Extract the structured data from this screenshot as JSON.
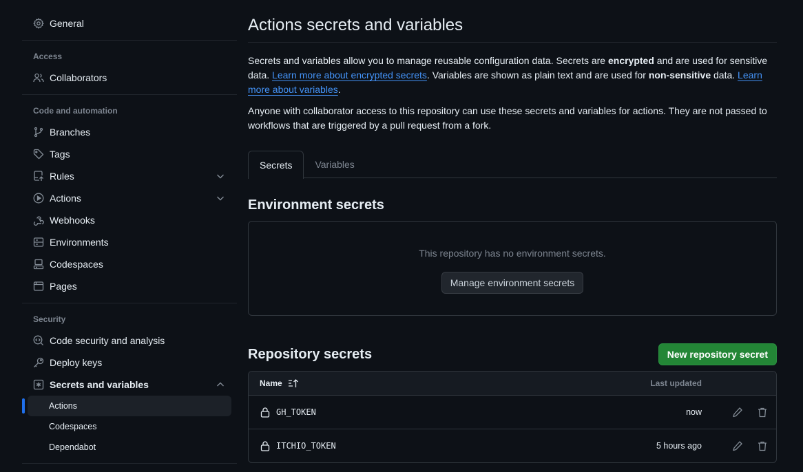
{
  "sidebar": {
    "general": {
      "label": "General",
      "icon": "gear-icon"
    },
    "sections": [
      {
        "heading": "Access",
        "items": [
          {
            "label": "Collaborators",
            "icon": "people-icon"
          }
        ]
      },
      {
        "heading": "Code and automation",
        "items": [
          {
            "label": "Branches",
            "icon": "git-branch-icon"
          },
          {
            "label": "Tags",
            "icon": "tag-icon"
          },
          {
            "label": "Rules",
            "icon": "rules-icon",
            "expandable": true,
            "expanded": false
          },
          {
            "label": "Actions",
            "icon": "play-icon",
            "expandable": true,
            "expanded": false
          },
          {
            "label": "Webhooks",
            "icon": "webhook-icon"
          },
          {
            "label": "Environments",
            "icon": "server-icon"
          },
          {
            "label": "Codespaces",
            "icon": "codespaces-icon"
          },
          {
            "label": "Pages",
            "icon": "browser-icon"
          }
        ]
      },
      {
        "heading": "Security",
        "items": [
          {
            "label": "Code security and analysis",
            "icon": "codescan-icon"
          },
          {
            "label": "Deploy keys",
            "icon": "key-icon"
          },
          {
            "label": "Secrets and variables",
            "icon": "asterisk-icon",
            "expandable": true,
            "expanded": true,
            "children": [
              {
                "label": "Actions",
                "active": true
              },
              {
                "label": "Codespaces"
              },
              {
                "label": "Dependabot"
              }
            ]
          }
        ]
      }
    ]
  },
  "main": {
    "title": "Actions secrets and variables",
    "description": {
      "p1_a": "Secrets and variables allow you to manage reusable configuration data. Secrets are ",
      "p1_bold1": "encrypted",
      "p1_b": " and are used for sensitive data. ",
      "p1_link1": "Learn more about encrypted secrets",
      "p1_c": ". Variables are shown as plain text and are used for ",
      "p1_bold2": "non-sensitive",
      "p1_d": " data. ",
      "p1_link2": "Learn more about variables",
      "p1_e": ".",
      "p2": "Anyone with collaborator access to this repository can use these secrets and variables for actions. They are not passed to workflows that are triggered by a pull request from a fork."
    },
    "tabs": [
      {
        "label": "Secrets",
        "active": true
      },
      {
        "label": "Variables",
        "active": false
      }
    ],
    "environment_secrets": {
      "title": "Environment secrets",
      "empty_text": "This repository has no environment secrets.",
      "manage_button": "Manage environment secrets"
    },
    "repository_secrets": {
      "title": "Repository secrets",
      "new_button": "New repository secret",
      "columns": {
        "name": "Name",
        "last_updated": "Last updated"
      },
      "rows": [
        {
          "name": "GH_TOKEN",
          "last_updated": "now"
        },
        {
          "name": "ITCHIO_TOKEN",
          "last_updated": "5 hours ago"
        }
      ]
    }
  },
  "colors": {
    "background": "#0d1117",
    "link": "#4493f8",
    "primary_button": "#238636",
    "active_indicator": "#1f6feb"
  }
}
